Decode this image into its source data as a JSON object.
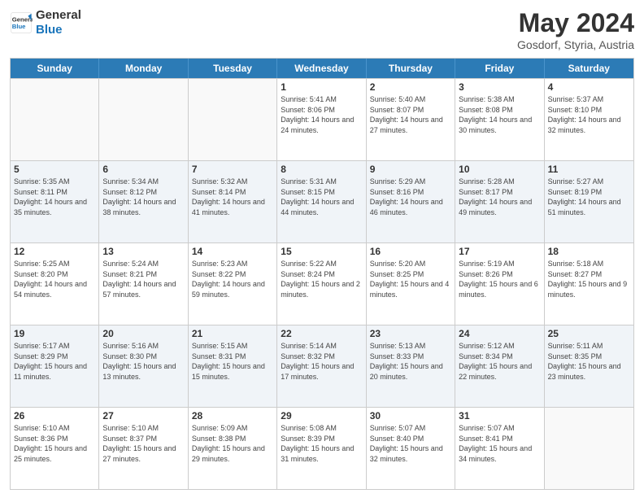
{
  "header": {
    "logo_general": "General",
    "logo_blue": "Blue",
    "month_title": "May 2024",
    "subtitle": "Gosdorf, Styria, Austria"
  },
  "days_of_week": [
    "Sunday",
    "Monday",
    "Tuesday",
    "Wednesday",
    "Thursday",
    "Friday",
    "Saturday"
  ],
  "weeks": [
    {
      "cells": [
        {
          "day": "",
          "empty": true
        },
        {
          "day": "",
          "empty": true
        },
        {
          "day": "",
          "empty": true
        },
        {
          "day": "1",
          "sunrise": "5:41 AM",
          "sunset": "8:06 PM",
          "daylight": "14 hours and 24 minutes."
        },
        {
          "day": "2",
          "sunrise": "5:40 AM",
          "sunset": "8:07 PM",
          "daylight": "14 hours and 27 minutes."
        },
        {
          "day": "3",
          "sunrise": "5:38 AM",
          "sunset": "8:08 PM",
          "daylight": "14 hours and 30 minutes."
        },
        {
          "day": "4",
          "sunrise": "5:37 AM",
          "sunset": "8:10 PM",
          "daylight": "14 hours and 32 minutes."
        }
      ]
    },
    {
      "shaded": true,
      "cells": [
        {
          "day": "5",
          "sunrise": "5:35 AM",
          "sunset": "8:11 PM",
          "daylight": "14 hours and 35 minutes."
        },
        {
          "day": "6",
          "sunrise": "5:34 AM",
          "sunset": "8:12 PM",
          "daylight": "14 hours and 38 minutes."
        },
        {
          "day": "7",
          "sunrise": "5:32 AM",
          "sunset": "8:14 PM",
          "daylight": "14 hours and 41 minutes."
        },
        {
          "day": "8",
          "sunrise": "5:31 AM",
          "sunset": "8:15 PM",
          "daylight": "14 hours and 44 minutes."
        },
        {
          "day": "9",
          "sunrise": "5:29 AM",
          "sunset": "8:16 PM",
          "daylight": "14 hours and 46 minutes."
        },
        {
          "day": "10",
          "sunrise": "5:28 AM",
          "sunset": "8:17 PM",
          "daylight": "14 hours and 49 minutes."
        },
        {
          "day": "11",
          "sunrise": "5:27 AM",
          "sunset": "8:19 PM",
          "daylight": "14 hours and 51 minutes."
        }
      ]
    },
    {
      "shaded": false,
      "cells": [
        {
          "day": "12",
          "sunrise": "5:25 AM",
          "sunset": "8:20 PM",
          "daylight": "14 hours and 54 minutes."
        },
        {
          "day": "13",
          "sunrise": "5:24 AM",
          "sunset": "8:21 PM",
          "daylight": "14 hours and 57 minutes."
        },
        {
          "day": "14",
          "sunrise": "5:23 AM",
          "sunset": "8:22 PM",
          "daylight": "14 hours and 59 minutes."
        },
        {
          "day": "15",
          "sunrise": "5:22 AM",
          "sunset": "8:24 PM",
          "daylight": "15 hours and 2 minutes."
        },
        {
          "day": "16",
          "sunrise": "5:20 AM",
          "sunset": "8:25 PM",
          "daylight": "15 hours and 4 minutes."
        },
        {
          "day": "17",
          "sunrise": "5:19 AM",
          "sunset": "8:26 PM",
          "daylight": "15 hours and 6 minutes."
        },
        {
          "day": "18",
          "sunrise": "5:18 AM",
          "sunset": "8:27 PM",
          "daylight": "15 hours and 9 minutes."
        }
      ]
    },
    {
      "shaded": true,
      "cells": [
        {
          "day": "19",
          "sunrise": "5:17 AM",
          "sunset": "8:29 PM",
          "daylight": "15 hours and 11 minutes."
        },
        {
          "day": "20",
          "sunrise": "5:16 AM",
          "sunset": "8:30 PM",
          "daylight": "15 hours and 13 minutes."
        },
        {
          "day": "21",
          "sunrise": "5:15 AM",
          "sunset": "8:31 PM",
          "daylight": "15 hours and 15 minutes."
        },
        {
          "day": "22",
          "sunrise": "5:14 AM",
          "sunset": "8:32 PM",
          "daylight": "15 hours and 17 minutes."
        },
        {
          "day": "23",
          "sunrise": "5:13 AM",
          "sunset": "8:33 PM",
          "daylight": "15 hours and 20 minutes."
        },
        {
          "day": "24",
          "sunrise": "5:12 AM",
          "sunset": "8:34 PM",
          "daylight": "15 hours and 22 minutes."
        },
        {
          "day": "25",
          "sunrise": "5:11 AM",
          "sunset": "8:35 PM",
          "daylight": "15 hours and 23 minutes."
        }
      ]
    },
    {
      "shaded": false,
      "cells": [
        {
          "day": "26",
          "sunrise": "5:10 AM",
          "sunset": "8:36 PM",
          "daylight": "15 hours and 25 minutes."
        },
        {
          "day": "27",
          "sunrise": "5:10 AM",
          "sunset": "8:37 PM",
          "daylight": "15 hours and 27 minutes."
        },
        {
          "day": "28",
          "sunrise": "5:09 AM",
          "sunset": "8:38 PM",
          "daylight": "15 hours and 29 minutes."
        },
        {
          "day": "29",
          "sunrise": "5:08 AM",
          "sunset": "8:39 PM",
          "daylight": "15 hours and 31 minutes."
        },
        {
          "day": "30",
          "sunrise": "5:07 AM",
          "sunset": "8:40 PM",
          "daylight": "15 hours and 32 minutes."
        },
        {
          "day": "31",
          "sunrise": "5:07 AM",
          "sunset": "8:41 PM",
          "daylight": "15 hours and 34 minutes."
        },
        {
          "day": "",
          "empty": true
        }
      ]
    }
  ],
  "labels": {
    "sunrise": "Sunrise:",
    "sunset": "Sunset:",
    "daylight": "Daylight hours"
  }
}
